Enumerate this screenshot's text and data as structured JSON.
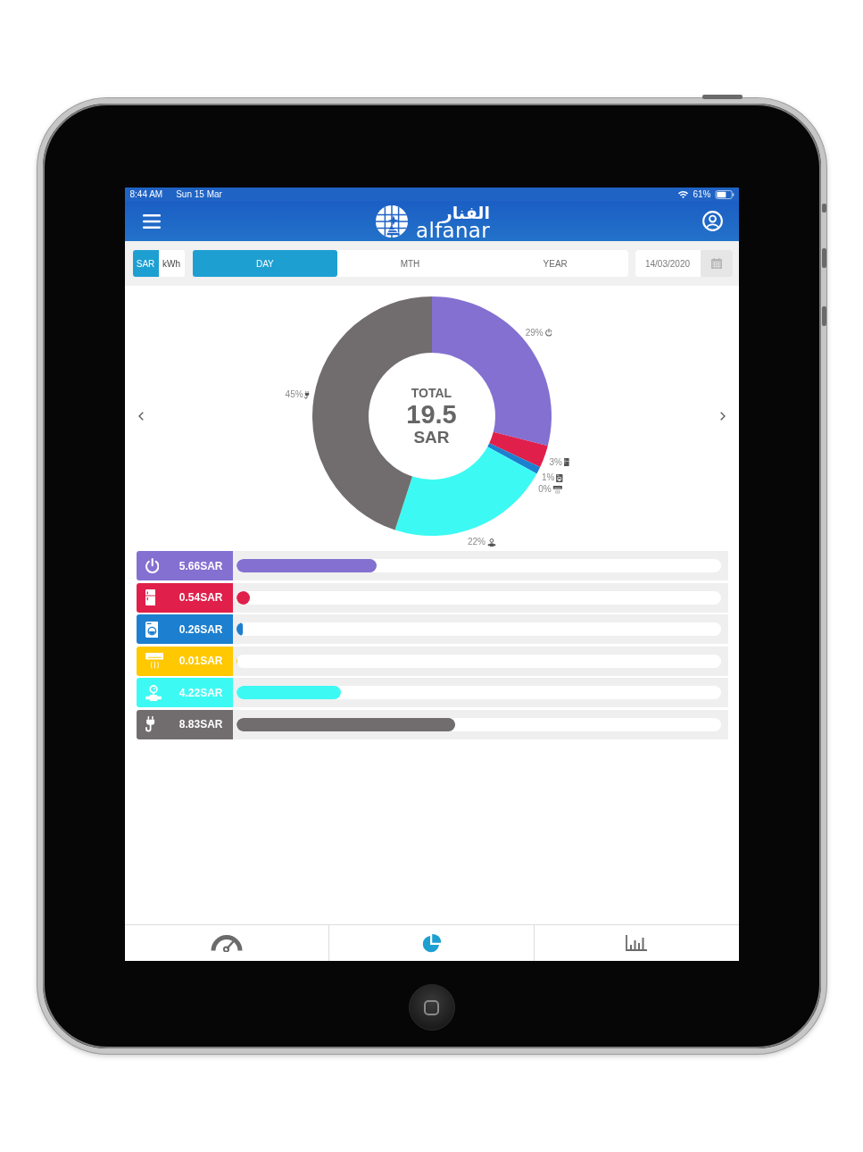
{
  "status_bar": {
    "time": "8:44 AM",
    "date": "Sun 15 Mar",
    "battery": "61%"
  },
  "header": {
    "logo_arabic": "الفنار",
    "logo_latin": "alfanar"
  },
  "unit_toggle": [
    {
      "label": "SAR",
      "selected": true
    },
    {
      "label": "kWh",
      "selected": false
    }
  ],
  "period_tabs": [
    {
      "label": "DAY",
      "selected": true
    },
    {
      "label": "MTH",
      "selected": false
    },
    {
      "label": "YEAR",
      "selected": false
    }
  ],
  "date_field": {
    "value": "14/03/2020"
  },
  "chart": {
    "total_label": "TOTAL",
    "total_value": "19.5",
    "total_unit": "SAR",
    "chart_data": {
      "type": "donut",
      "values": [
        29,
        3,
        1,
        0,
        22,
        45
      ],
      "value_labels": [
        "29%",
        "3%",
        "1%",
        "0%",
        "22%",
        "45%"
      ]
    }
  },
  "consumers": [
    {
      "kind": "power",
      "color": "#8470d1",
      "value": "5.66SAR",
      "level": 0.29
    },
    {
      "kind": "fridge",
      "color": "#e01f4b",
      "value": "0.54SAR",
      "level": 0.028
    },
    {
      "kind": "washer",
      "color": "#1d7fcf",
      "value": "0.26SAR",
      "level": 0.013
    },
    {
      "kind": "ac",
      "color": "#ffc800",
      "value": "0.01SAR",
      "level": 0.001
    },
    {
      "kind": "water",
      "color": "#3cfaf3",
      "value": "4.22SAR",
      "level": 0.216
    },
    {
      "kind": "plug",
      "color": "#716d6e",
      "value": "8.83SAR",
      "level": 0.453
    }
  ],
  "bottom_nav": [
    {
      "kind": "gauge",
      "selected": false
    },
    {
      "kind": "pie",
      "selected": true
    },
    {
      "kind": "bars",
      "selected": false
    }
  ]
}
